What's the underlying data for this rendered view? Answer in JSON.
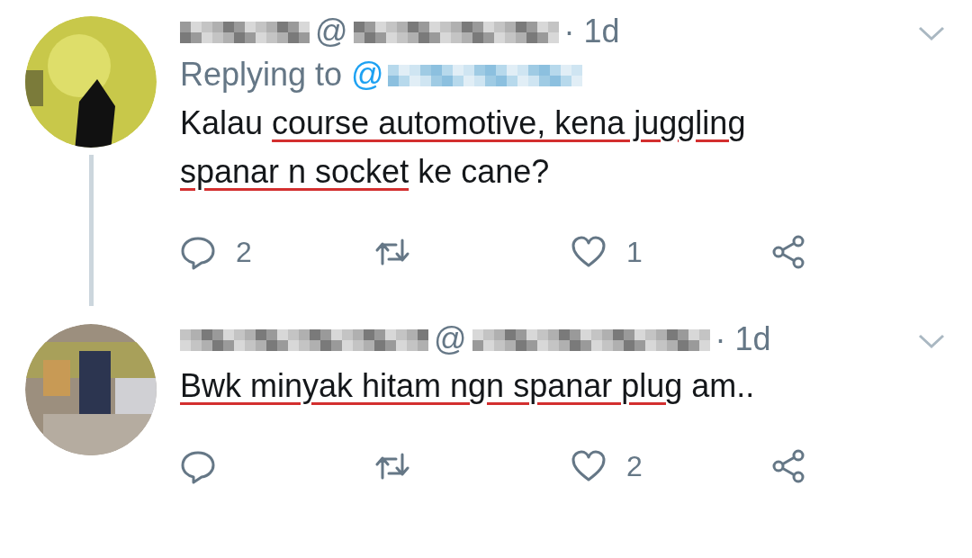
{
  "tweets": [
    {
      "author_mark": "@",
      "time": "· 1d",
      "replying_to": {
        "label": "Replying to",
        "mark": "@"
      },
      "thread_line": true,
      "text": [
        {
          "text": "Kalau ",
          "misspelled": false
        },
        {
          "text": "course automotive, kena juggling ",
          "misspelled": true
        },
        {
          "text": "spanar n socket",
          "misspelled": true
        },
        {
          "text": " ke cane?",
          "misspelled": false
        }
      ],
      "actions": {
        "replies": "2",
        "likes": "1"
      }
    },
    {
      "author_mark": "@",
      "time": "· 1d",
      "thread_line": false,
      "text": [
        {
          "text": "Bwk minyak hitam ngn spanar plug",
          "misspelled": true
        },
        {
          "text": " am..",
          "misspelled": false
        }
      ],
      "actions": {
        "likes": "2"
      }
    }
  ]
}
